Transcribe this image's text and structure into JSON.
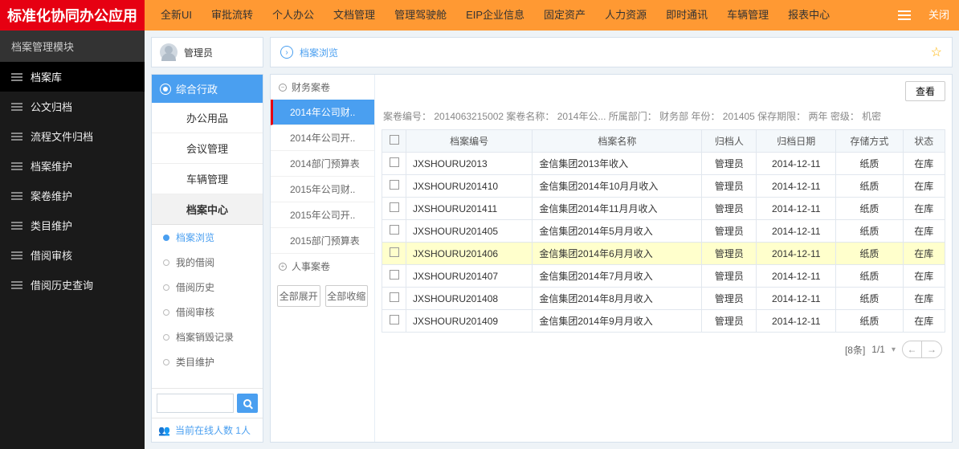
{
  "brand": "标准化协同办公应用",
  "topnav": [
    "全新UI",
    "审批流转",
    "个人办公",
    "文档管理",
    "管理驾驶舱",
    "EIP企业信息",
    "固定资产",
    "人力资源",
    "即时通讯",
    "车辆管理",
    "报表中心"
  ],
  "close_label": "关闭",
  "left_header": "档案管理模块",
  "left_menu": [
    "档案库",
    "公文归档",
    "流程文件归档",
    "档案维护",
    "案卷维护",
    "类目维护",
    "借阅审核",
    "借阅历史查询"
  ],
  "left_active": 0,
  "user_panel": {
    "name": "管理员"
  },
  "cat_active_label": "综合行政",
  "cat_items": [
    "办公用品",
    "会议管理",
    "车辆管理"
  ],
  "cat_center_header": "档案中心",
  "cat_subs": [
    "档案浏览",
    "我的借阅",
    "借阅历史",
    "借阅审核",
    "档案销毁记录",
    "类目维护"
  ],
  "cat_sub_active": 0,
  "online_label": "当前在线人数 1人",
  "breadcrumb_title": "档案浏览",
  "tree": {
    "group1": "财务案卷",
    "leaves": [
      "2014年公司财..",
      "2014年公司开..",
      "2014部门预算表",
      "2015年公司财..",
      "2015年公司开..",
      "2015部门预算表"
    ],
    "leaf_selected": 0,
    "group2": "人事案卷",
    "btn_expand": "全部展开",
    "btn_collapse": "全部收缩"
  },
  "look_btn": "查看",
  "meta_line": "案卷编号： 2014063215002  案卷名称： 2014年公...  所属部门： 财务部  年份： 201405  保存期限： 两年  密级： 机密",
  "table": {
    "headers": [
      "",
      "档案编号",
      "档案名称",
      "归档人",
      "归档日期",
      "存储方式",
      "状态"
    ],
    "rows": [
      [
        "JXSHOURU2013",
        "金信集团2013年收入",
        "管理员",
        "2014-12-11",
        "纸质",
        "在库"
      ],
      [
        "JXSHOURU201410",
        "金信集团2014年10月月收入",
        "管理员",
        "2014-12-11",
        "纸质",
        "在库"
      ],
      [
        "JXSHOURU201411",
        "金信集团2014年11月月收入",
        "管理员",
        "2014-12-11",
        "纸质",
        "在库"
      ],
      [
        "JXSHOURU201405",
        "金信集团2014年5月月收入",
        "管理员",
        "2014-12-11",
        "纸质",
        "在库"
      ],
      [
        "JXSHOURU201406",
        "金信集团2014年6月月收入",
        "管理员",
        "2014-12-11",
        "纸质",
        "在库"
      ],
      [
        "JXSHOURU201407",
        "金信集团2014年7月月收入",
        "管理员",
        "2014-12-11",
        "纸质",
        "在库"
      ],
      [
        "JXSHOURU201408",
        "金信集团2014年8月月收入",
        "管理员",
        "2014-12-11",
        "纸质",
        "在库"
      ],
      [
        "JXSHOURU201409",
        "金信集团2014年9月月收入",
        "管理员",
        "2014-12-11",
        "纸质",
        "在库"
      ]
    ],
    "highlight_row": 4
  },
  "pager": {
    "total": "[8条]",
    "pages": "1/1"
  }
}
